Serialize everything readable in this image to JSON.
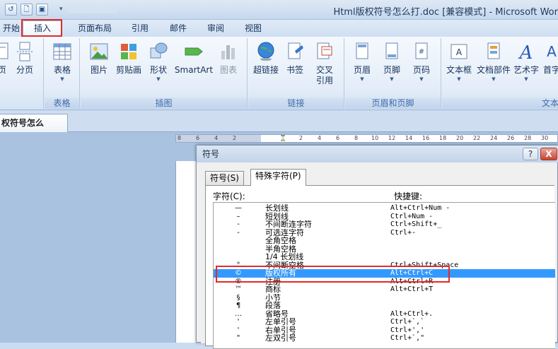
{
  "window": {
    "title": "Html版权符号怎么打.doc [兼容模式] - Microsoft Wor",
    "qat": {
      "undo_icon": "undo-icon",
      "print_preview_icon": "print-preview-icon",
      "save_icon": "save-icon"
    }
  },
  "tabs": [
    {
      "label": "开始"
    },
    {
      "label": "插入"
    },
    {
      "label": "页面布局"
    },
    {
      "label": "引用"
    },
    {
      "label": "邮件"
    },
    {
      "label": "审阅"
    },
    {
      "label": "视图"
    }
  ],
  "ribbon": {
    "groups": [
      {
        "label": "",
        "buttons": [
          {
            "label": "页"
          },
          {
            "label": "分页"
          }
        ]
      },
      {
        "label": "表格",
        "buttons": [
          {
            "label": "表格"
          }
        ]
      },
      {
        "label": "插图",
        "buttons": [
          {
            "label": "图片"
          },
          {
            "label": "剪贴画"
          },
          {
            "label": "形状"
          },
          {
            "label": "SmartArt"
          },
          {
            "label": "图表"
          }
        ]
      },
      {
        "label": "链接",
        "buttons": [
          {
            "label": "超链接"
          },
          {
            "label": "书签"
          },
          {
            "label": "交叉引用"
          }
        ]
      },
      {
        "label": "页眉和页脚",
        "buttons": [
          {
            "label": "页眉"
          },
          {
            "label": "页脚"
          },
          {
            "label": "页码"
          }
        ]
      },
      {
        "label": "文本",
        "buttons": [
          {
            "label": "文本框"
          },
          {
            "label": "文档部件"
          },
          {
            "label": "艺术字"
          },
          {
            "label": "首字"
          }
        ]
      }
    ]
  },
  "document": {
    "tab_label": "权符号怎么打.doc"
  },
  "ruler": {
    "ticks": [
      "8",
      "6",
      "4",
      "2",
      "",
      "2",
      "4",
      "6",
      "8",
      "10",
      "12",
      "14",
      "16",
      "18",
      "20",
      "22",
      "24",
      "26",
      "28",
      "30"
    ]
  },
  "dialog": {
    "title": "符号",
    "help_label": "?",
    "close_label": "X",
    "tabs": [
      {
        "label": "符号(S)"
      },
      {
        "label": "特殊字符(P)"
      }
    ],
    "columns": {
      "char": "字符(C):",
      "shortcut": "快捷键:"
    },
    "rows": [
      {
        "sym": "—",
        "name": "长划线",
        "shortcut": "Alt+Ctrl+Num -"
      },
      {
        "sym": "–",
        "name": "短划线",
        "shortcut": "Ctrl+Num -"
      },
      {
        "sym": "-",
        "name": "不间断连字符",
        "shortcut": "Ctrl+Shift+_"
      },
      {
        "sym": "-",
        "name": "可选连字符",
        "shortcut": "Ctrl+-"
      },
      {
        "sym": "",
        "name": "全角空格",
        "shortcut": ""
      },
      {
        "sym": "",
        "name": "半角空格",
        "shortcut": ""
      },
      {
        "sym": "",
        "name": "1/4 长划线",
        "shortcut": ""
      },
      {
        "sym": "°",
        "name": "不间断空格",
        "shortcut": "Ctrl+Shift+Space"
      },
      {
        "sym": "©",
        "name": "版权所有",
        "shortcut": "Alt+Ctrl+C",
        "selected": true
      },
      {
        "sym": "®",
        "name": "注册",
        "shortcut": "Alt+Ctrl+R"
      },
      {
        "sym": "™",
        "name": "商标",
        "shortcut": "Alt+Ctrl+T"
      },
      {
        "sym": "§",
        "name": "小节",
        "shortcut": ""
      },
      {
        "sym": "¶",
        "name": "段落",
        "shortcut": ""
      },
      {
        "sym": "…",
        "name": "省略号",
        "shortcut": "Alt+Ctrl+."
      },
      {
        "sym": "'",
        "name": "左单引号",
        "shortcut": "Ctrl+`,`"
      },
      {
        "sym": "'",
        "name": "右单引号",
        "shortcut": "Ctrl+','"
      },
      {
        "sym": "\"",
        "name": "左双引号",
        "shortcut": "Ctrl+`,\""
      }
    ]
  },
  "colors": {
    "highlight_red": "#e12a2a",
    "selection_blue": "#3399ff"
  }
}
